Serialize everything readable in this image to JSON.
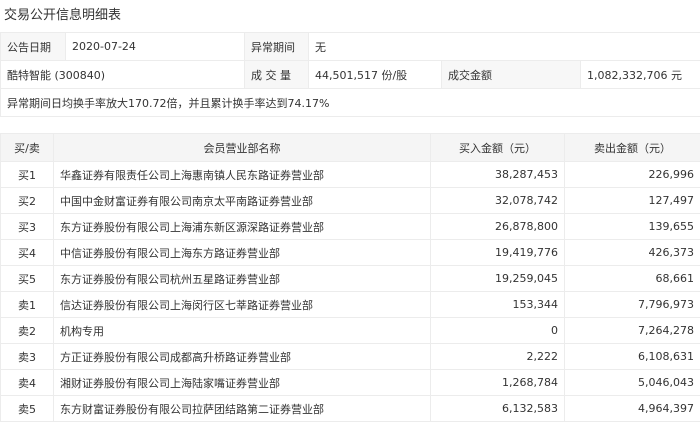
{
  "title": "交易公开信息明细表",
  "info": {
    "date_label": "公告日期",
    "date": "2020-07-24",
    "period_label": "异常期间",
    "period": "无",
    "stock": "酷特智能 (300840)",
    "volume_label": "成 交 量",
    "volume": "44,501,517 份/股",
    "amount_label": "成交金额",
    "amount": "1,082,332,706 元",
    "note": "异常期间日均换手率放大170.72倍，并且累计换手率达到74.17%"
  },
  "table": {
    "headers": [
      "买/卖",
      "会员营业部名称",
      "买入金额（元）",
      "卖出金额（元）"
    ],
    "rows": [
      [
        "买1",
        "华鑫证券有限责任公司上海惠南镇人民东路证券营业部",
        "38,287,453",
        "226,996"
      ],
      [
        "买2",
        "中国中金财富证券有限公司南京太平南路证券营业部",
        "32,078,742",
        "127,497"
      ],
      [
        "买3",
        "东方证券股份有限公司上海浦东新区源深路证券营业部",
        "26,878,800",
        "139,655"
      ],
      [
        "买4",
        "中信证券股份有限公司上海东方路证券营业部",
        "19,419,776",
        "426,373"
      ],
      [
        "买5",
        "东方证券股份有限公司杭州五星路证券营业部",
        "19,259,045",
        "68,661"
      ],
      [
        "卖1",
        "信达证券股份有限公司上海闵行区七莘路证券营业部",
        "153,344",
        "7,796,973"
      ],
      [
        "卖2",
        "机构专用",
        "0",
        "7,264,278"
      ],
      [
        "卖3",
        "方正证券股份有限公司成都高升桥路证券营业部",
        "2,222",
        "6,108,631"
      ],
      [
        "卖4",
        "湘财证券股份有限公司上海陆家嘴证券营业部",
        "1,268,784",
        "5,046,043"
      ],
      [
        "卖5",
        "东方财富证券股份有限公司拉萨团结路第二证券营业部",
        "6,132,583",
        "4,964,397"
      ]
    ]
  }
}
